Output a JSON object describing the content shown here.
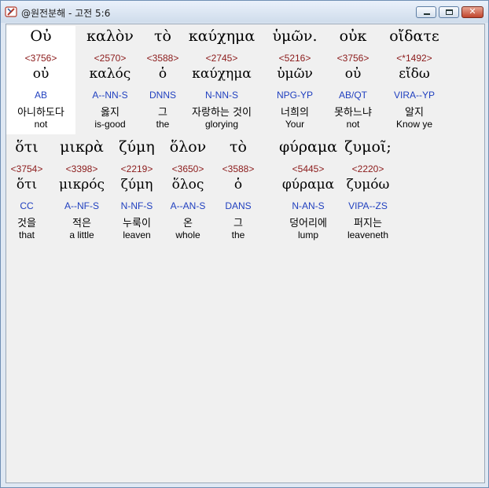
{
  "window": {
    "title": "@원전분해 - 고전 5:6",
    "icons": {
      "app": "bible-book-icon",
      "minimize": "minimize-icon",
      "maximize": "maximize-icon",
      "close": "close-icon"
    },
    "close_glyph": "✕"
  },
  "colors": {
    "strong": "#8b1a1a",
    "parse": "#1f3fbf",
    "selected_bg": "#ffffff"
  },
  "words": [
    {
      "greek": "Οὐ",
      "strong": "<3756>",
      "lemma": "οὐ",
      "parse": "AB",
      "korean": "아니하도다",
      "english": "not",
      "selected": true
    },
    {
      "greek": "καλὸν",
      "strong": "<2570>",
      "lemma": "καλός",
      "parse": "A--NN-S",
      "korean": "옳지",
      "english": "is-good"
    },
    {
      "greek": "τὸ",
      "strong": "<3588>",
      "lemma": "ὁ",
      "parse": "DNNS",
      "korean": "그",
      "english": "the"
    },
    {
      "greek": "καύχημα",
      "strong": "<2745>",
      "lemma": "καύχημα",
      "parse": "N-NN-S",
      "korean": "자랑하는 것이",
      "english": "glorying"
    },
    {
      "greek": "ὑμῶν.",
      "strong": "<5216>",
      "lemma": "ὑμῶν",
      "parse": "NPG-YP",
      "korean": "너희의",
      "english": "Your"
    },
    {
      "greek": "οὐκ",
      "strong": "<3756>",
      "lemma": "οὐ",
      "parse": "AB/QT",
      "korean": "못하느냐",
      "english": "not"
    },
    {
      "greek": "οἴδατε",
      "strong": "<*1492>",
      "lemma": "εἴδω",
      "parse": "VIRA--YP",
      "korean": "알지",
      "english": "Know ye"
    },
    {
      "greek": "ὅτι",
      "strong": "<3754>",
      "lemma": "ὅτι",
      "parse": "CC",
      "korean": "것을",
      "english": "that"
    },
    {
      "greek": "μικρὰ",
      "strong": "<3398>",
      "lemma": "μικρός",
      "parse": "A--NF-S",
      "korean": "적은",
      "english": "a little"
    },
    {
      "greek": "ζύμη",
      "strong": "<2219>",
      "lemma": "ζύμη",
      "parse": "N-NF-S",
      "korean": "누룩이",
      "english": "leaven"
    },
    {
      "greek": "ὅλον",
      "strong": "<3650>",
      "lemma": "ὅλος",
      "parse": "A--AN-S",
      "korean": "온",
      "english": "whole"
    },
    {
      "greek": "τὸ",
      "strong": "<3588>",
      "lemma": "ὁ",
      "parse": "DANS",
      "korean": "그",
      "english": "the"
    },
    {
      "greek": "φύραμα",
      "strong": "<5445>",
      "lemma": "φύραμα",
      "parse": "N-AN-S",
      "korean": "덩어리에",
      "english": "lump"
    },
    {
      "greek": "ζυμοῖ;",
      "strong": "<2220>",
      "lemma": "ζυμόω",
      "parse": "VIPA--ZS",
      "korean": "퍼지는",
      "english": "leaveneth"
    }
  ]
}
